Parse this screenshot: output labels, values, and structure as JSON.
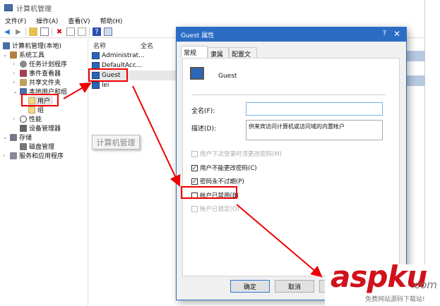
{
  "window": {
    "title": "计算机管理"
  },
  "menu": [
    "文件(F)",
    "操作(A)",
    "查看(V)",
    "帮助(H)"
  ],
  "tree": {
    "root": "计算机管理(本地)",
    "system_tools": "系统工具",
    "task_scheduler": "任务计划程序",
    "event_viewer": "事件查看器",
    "shared_folders": "共享文件夹",
    "local_users": "本地用户和组",
    "users": "用户",
    "groups": "组",
    "performance": "性能",
    "device_manager": "设备管理器",
    "storage": "存储",
    "disk_management": "磁盘管理",
    "services": "服务和应用程序"
  },
  "list": {
    "columns": [
      "名称",
      "全名"
    ],
    "items": [
      "Administrat...",
      "DefaultAcc...",
      "Guest",
      "lei"
    ]
  },
  "tooltip": "计算机管理",
  "dialog": {
    "title": "Guest 属性",
    "help": "?",
    "close": "✕",
    "tabs": [
      "常规",
      "隶属于",
      "配置文件"
    ],
    "user": "Guest",
    "fullname_label": "全名(F):",
    "fullname_value": "",
    "description_label": "描述(D):",
    "description_value": "供来宾访问计算机或访问域的内置帐户",
    "checkboxes": [
      {
        "label": "用户下次登录时须更改密码(M)",
        "checked": false,
        "disabled": true
      },
      {
        "label": "用户不能更改密码(C)",
        "checked": true,
        "disabled": false
      },
      {
        "label": "密码永不过期(P)",
        "checked": true,
        "disabled": false
      },
      {
        "label": "帐户已禁用(B)",
        "checked": false,
        "disabled": false
      },
      {
        "label": "帐户已锁定(O)",
        "checked": false,
        "disabled": true
      }
    ],
    "ok": "确定",
    "cancel": "取消"
  },
  "watermark": {
    "brand": "aspku",
    ".com": ".com",
    "slogan": "免费网站源码下载站!"
  },
  "colors": {
    "accent": "#2b6cc4",
    "annotation": "#e00000"
  }
}
